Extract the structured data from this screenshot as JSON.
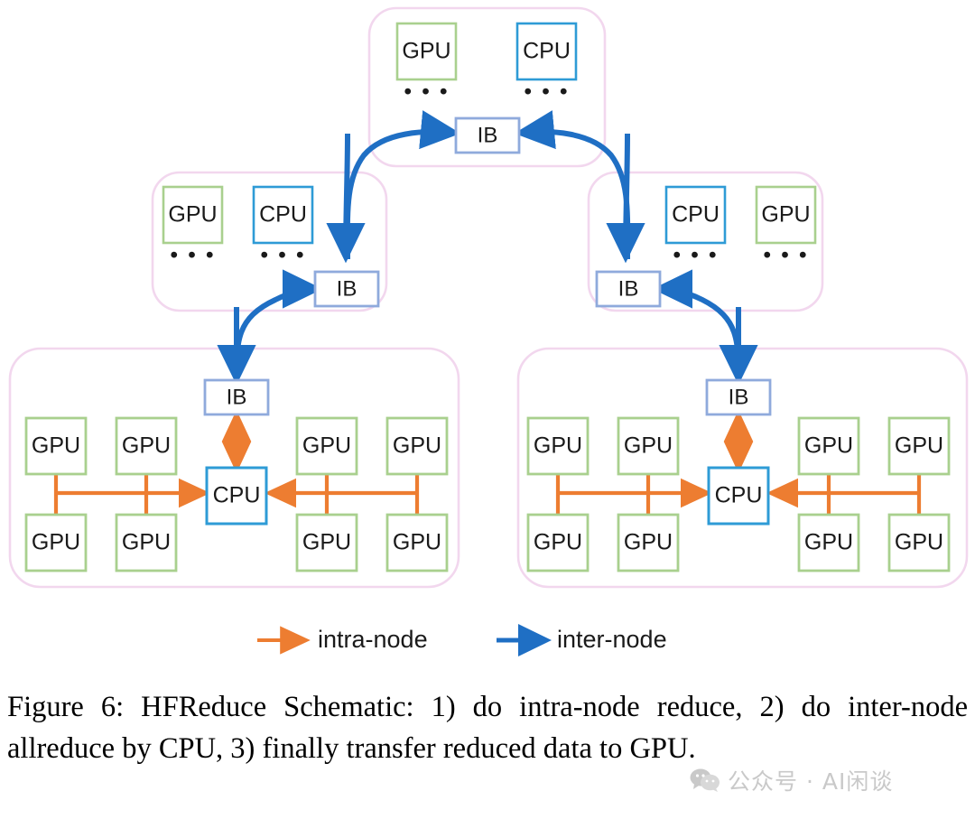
{
  "figure": {
    "caption": "Figure 6: HFReduce Schematic: 1) do intra-node reduce, 2) do inter-node allreduce by CPU, 3) finally transfer reduced data to GPU.",
    "watermark_text": "公众号 · AI闲谈"
  },
  "colors": {
    "gpu_border": "#A9D08E",
    "cpu_border": "#2E9BD6",
    "ib_border": "#8FAADC",
    "node_container_border": "#F2D7EE",
    "intra_node_arrow": "#ED7D31",
    "inter_node_arrow": "#1F6FC4",
    "box_fill": "#FFFFFF",
    "text": "#1A1A1A"
  },
  "labels": {
    "gpu": "GPU",
    "cpu": "CPU",
    "ib": "IB",
    "ellipsis": "• • •"
  },
  "legend": {
    "items": [
      {
        "label": "intra-node",
        "color": "#ED7D31",
        "name": "intra-node"
      },
      {
        "label": "inter-node",
        "color": "#1F6FC4",
        "name": "inter-node"
      }
    ]
  },
  "nodes": {
    "top": {
      "name": "top-aggregator-node",
      "boxes": [
        {
          "type": "gpu",
          "label": "GPU",
          "ellipsis": "• • •"
        },
        {
          "type": "cpu",
          "label": "CPU",
          "ellipsis": "• • •"
        }
      ],
      "ib": {
        "label": "IB"
      }
    },
    "middle_left": {
      "name": "middle-left-node",
      "boxes": [
        {
          "type": "gpu",
          "label": "GPU",
          "ellipsis": "• • •"
        },
        {
          "type": "cpu",
          "label": "CPU",
          "ellipsis": "• • •"
        }
      ],
      "ib": {
        "label": "IB"
      }
    },
    "middle_right": {
      "name": "middle-right-node",
      "boxes": [
        {
          "type": "cpu",
          "label": "CPU",
          "ellipsis": "• • •"
        },
        {
          "type": "gpu",
          "label": "GPU",
          "ellipsis": "• • •"
        }
      ],
      "ib": {
        "label": "IB"
      }
    },
    "bottom_left": {
      "name": "bottom-left-node",
      "ib": {
        "label": "IB"
      },
      "cpu": {
        "label": "CPU"
      },
      "gpus": [
        {
          "label": "GPU",
          "position": "top-left-1"
        },
        {
          "label": "GPU",
          "position": "top-left-2"
        },
        {
          "label": "GPU",
          "position": "top-right-1"
        },
        {
          "label": "GPU",
          "position": "top-right-2"
        },
        {
          "label": "GPU",
          "position": "bottom-left-1"
        },
        {
          "label": "GPU",
          "position": "bottom-left-2"
        },
        {
          "label": "GPU",
          "position": "bottom-right-1"
        },
        {
          "label": "GPU",
          "position": "bottom-right-2"
        }
      ]
    },
    "bottom_right": {
      "name": "bottom-right-node",
      "ib": {
        "label": "IB"
      },
      "cpu": {
        "label": "CPU"
      },
      "gpus": [
        {
          "label": "GPU",
          "position": "top-left-1"
        },
        {
          "label": "GPU",
          "position": "top-left-2"
        },
        {
          "label": "GPU",
          "position": "top-right-1"
        },
        {
          "label": "GPU",
          "position": "top-right-2"
        },
        {
          "label": "GPU",
          "position": "bottom-left-1"
        },
        {
          "label": "GPU",
          "position": "bottom-left-2"
        },
        {
          "label": "GPU",
          "position": "bottom-right-1"
        },
        {
          "label": "GPU",
          "position": "bottom-right-2"
        }
      ]
    }
  }
}
